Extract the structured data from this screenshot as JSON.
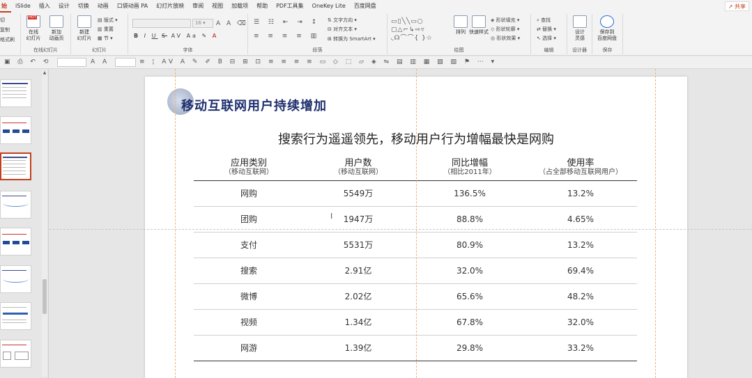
{
  "menubar": {
    "tabs": [
      "始",
      "iSlide",
      "插入",
      "设计",
      "切换",
      "动画",
      "口袋动画 PA",
      "幻灯片放映",
      "审阅",
      "视图",
      "加载项",
      "帮助",
      "PDF工具集",
      "OneKey Lite",
      "百度网盘"
    ],
    "share": "共享"
  },
  "ribbon": {
    "clipboard_items": [
      "切",
      "复制",
      "格式刷"
    ],
    "new_slide": {
      "hot_badge": "HOT",
      "online_label": "在线\n幻灯片",
      "new_label": "新加\n动画页",
      "new_slide_label": "新建\n幻灯片",
      "layout": "版式",
      "reset": "重置",
      "section": "节"
    },
    "slides_group_label": "幻灯片",
    "online_group_label": "在线幻灯片",
    "font": {
      "size": "16",
      "bold": "B",
      "italic": "I",
      "underline": "U",
      "strike": "S",
      "spacing": "AV",
      "case": "Aa",
      "group_label": "字体"
    },
    "paragraph": {
      "text_direction": "文字方向",
      "align_text": "对齐文本",
      "smartart": "转换为 SmartArt",
      "group_label": "段落"
    },
    "drawing": {
      "arrange": "排列",
      "quick_styles": "快速样式",
      "shape_fill": "形状填充",
      "shape_outline": "形状轮廓",
      "shape_effects": "形状效果",
      "group_label": "绘图"
    },
    "editing": {
      "find": "查找",
      "replace": "替换",
      "select": "选择",
      "group_label": "编辑"
    },
    "designer": {
      "label": "设计\n灵感",
      "group_label": "设计器"
    },
    "save": {
      "label": "保存到\n百度网盘",
      "group_label": "保存"
    }
  },
  "slide": {
    "title": "移动互联网用户持续增加",
    "subtitle": "搜索行为遥遥领先，移动用户行为增幅最快是网购",
    "columns": [
      {
        "title": "应用类别",
        "note": "（移动互联网）"
      },
      {
        "title": "用户数",
        "note": "（移动互联网）"
      },
      {
        "title": "同比增幅",
        "note": "（相比2011年）"
      },
      {
        "title": "使用率",
        "note": "（占全部移动互联网用户）"
      }
    ],
    "rows": [
      [
        "网购",
        "5549万",
        "136.5%",
        "13.2%"
      ],
      [
        "团购",
        "1947万",
        "88.8%",
        "4.65%"
      ],
      [
        "支付",
        "5531万",
        "80.9%",
        "13.2%"
      ],
      [
        "搜索",
        "2.91亿",
        "32.0%",
        "69.4%"
      ],
      [
        "微博",
        "2.02亿",
        "65.6%",
        "48.2%"
      ],
      [
        "视频",
        "1.34亿",
        "67.8%",
        "32.0%"
      ],
      [
        "网游",
        "1.39亿",
        "29.8%",
        "33.2%"
      ]
    ]
  },
  "colors": {
    "accent": "#c43e1c",
    "title_blue": "#1e2f6e",
    "guide": "#f0b37a"
  }
}
